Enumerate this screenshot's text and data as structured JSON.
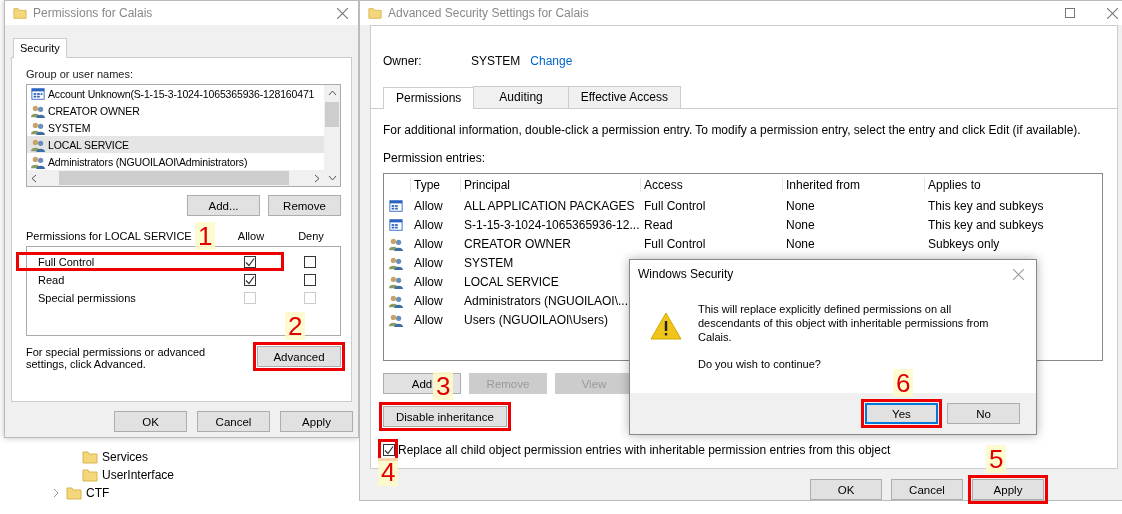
{
  "left_dialog": {
    "title": "Permissions for Calais",
    "tabs": [
      {
        "label": "Security",
        "selected": true
      }
    ],
    "group_label": "Group or user names:",
    "users": [
      {
        "kind": "app",
        "name": "Account Unknown(S-1-15-3-1024-1065365936-128160471",
        "selected": false
      },
      {
        "kind": "group",
        "name": "CREATOR OWNER",
        "selected": false
      },
      {
        "kind": "group",
        "name": "SYSTEM",
        "selected": false
      },
      {
        "kind": "group",
        "name": "LOCAL SERVICE",
        "selected": true
      },
      {
        "kind": "group",
        "name": "Administrators (NGUOILAOI\\Administrators)",
        "selected": false
      }
    ],
    "user_buttons": [
      {
        "label": "Add..."
      },
      {
        "label": "Remove"
      }
    ],
    "permissions_label": "Permissions for LOCAL SERVICE",
    "allow_header": "Allow",
    "deny_header": "Deny",
    "permissions": [
      {
        "name": "Full Control",
        "allow": {
          "checked": true,
          "disabled": false
        },
        "deny": {
          "checked": false,
          "disabled": false
        },
        "callout": "1"
      },
      {
        "name": "Read",
        "allow": {
          "checked": true,
          "disabled": false
        },
        "deny": {
          "checked": false,
          "disabled": false
        }
      },
      {
        "name": "Special permissions",
        "allow": {
          "checked": false,
          "disabled": true
        },
        "deny": {
          "checked": false,
          "disabled": true
        }
      }
    ],
    "advanced_note": "For special permissions or advanced settings, click Advanced.",
    "advanced_button": {
      "label": "Advanced",
      "callout": "2"
    },
    "footer_buttons": [
      {
        "label": "OK"
      },
      {
        "label": "Cancel"
      },
      {
        "label": "Apply"
      }
    ]
  },
  "tree": {
    "items": [
      {
        "children": [
          {
            "name": "Services"
          },
          {
            "name": "UserInterface"
          }
        ]
      },
      {
        "name": "CTF",
        "expanded": false
      }
    ]
  },
  "right_window": {
    "title": "Advanced Security Settings for Calais",
    "owner_label": "Owner:",
    "owner": "SYSTEM",
    "change_link": "Change",
    "tabs": [
      {
        "label": "Permissions",
        "selected": true
      },
      {
        "label": "Auditing",
        "selected": false
      },
      {
        "label": "Effective Access",
        "selected": false
      }
    ],
    "info": "For additional information, double-click a permission entry. To modify a permission entry, select the entry and click Edit (if available).",
    "entries_label": "Permission entries:",
    "columns": [
      "Type",
      "Principal",
      "Access",
      "Inherited from",
      "Applies to"
    ],
    "rows": [
      {
        "kind": "app",
        "type": "Allow",
        "principal": "ALL APPLICATION PACKAGES",
        "access": "Full Control",
        "inherited_from": "None",
        "applies_to": "This key and subkeys"
      },
      {
        "kind": "app",
        "type": "Allow",
        "principal": "S-1-15-3-1024-1065365936-12...",
        "access": "Read",
        "inherited_from": "None",
        "applies_to": "This key and subkeys"
      },
      {
        "kind": "group",
        "type": "Allow",
        "principal": "CREATOR OWNER",
        "access": "Full Control",
        "inherited_from": "None",
        "applies_to": "Subkeys only"
      },
      {
        "kind": "group",
        "type": "Allow",
        "principal": "SYSTEM"
      },
      {
        "kind": "group",
        "type": "Allow",
        "principal": "LOCAL SERVICE"
      },
      {
        "kind": "group",
        "type": "Allow",
        "principal": "Administrators (NGUOILAOI\\..."
      },
      {
        "kind": "group",
        "type": "Allow",
        "principal": "Users (NGUOILAOI\\Users)"
      }
    ],
    "entry_buttons": [
      {
        "label": "Add",
        "disabled": false
      },
      {
        "label": "Remove",
        "disabled": true
      },
      {
        "label": "View",
        "disabled": true
      }
    ],
    "inheritance_button": {
      "label": "Disable inheritance",
      "callout": "3"
    },
    "replace_option": {
      "label": "Replace all child object permission entries with inheritable permission entries from this object",
      "checked": true,
      "callout": "4"
    },
    "footer_buttons": [
      {
        "label": "OK"
      },
      {
        "label": "Cancel"
      },
      {
        "label": "Apply",
        "callout": "5"
      }
    ]
  },
  "modal": {
    "title": "Windows Security",
    "message": "This will replace explicitly defined permissions on all descendants of this object with inheritable permissions from Calais.",
    "question": "Do you wish to continue?",
    "buttons": [
      {
        "label": "Yes",
        "default": true,
        "callout": "6"
      },
      {
        "label": "No",
        "default": false
      }
    ]
  }
}
